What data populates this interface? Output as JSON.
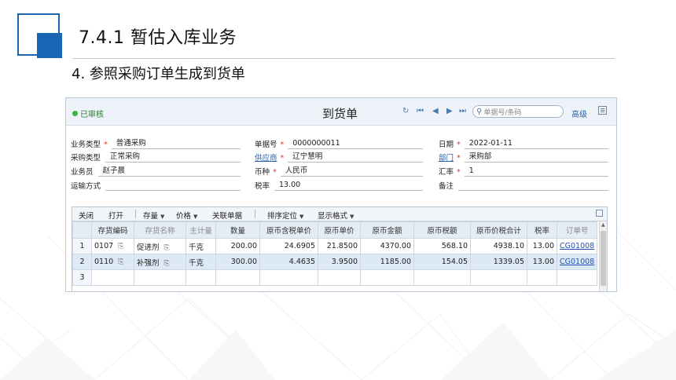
{
  "slide": {
    "title": "7.4.1  暂估入库业务",
    "subtitle": "4. 参照采购订单生成到货单"
  },
  "window": {
    "status": "已审核",
    "form_title": "到货单",
    "search_placeholder": "单据号/条码",
    "advanced_label": "高级",
    "nav": {
      "refresh": "↻",
      "first": "⏮",
      "prev": "◀",
      "next": "▶",
      "last": "⏭"
    }
  },
  "header_fields": {
    "biz_type": {
      "label": "业务类型",
      "value": "普通采购"
    },
    "purchase_type": {
      "label": "采购类型",
      "value": "正常采购"
    },
    "salesman": {
      "label": "业务员",
      "value": "赵子晨"
    },
    "transport": {
      "label": "运输方式",
      "value": ""
    },
    "doc_no": {
      "label": "单据号",
      "value": "0000000011"
    },
    "supplier": {
      "label": "供应商",
      "value": "辽宁慧明"
    },
    "currency": {
      "label": "币种",
      "value": "人民币"
    },
    "tax_rate": {
      "label": "税率",
      "value": "13.00"
    },
    "date": {
      "label": "日期",
      "value": "2022-01-11"
    },
    "dept": {
      "label": "部门",
      "value": "采购部"
    },
    "exrate": {
      "label": "汇率",
      "value": "1"
    },
    "remark": {
      "label": "备注",
      "value": ""
    }
  },
  "toolbar": {
    "close": "关闭",
    "open": "打开",
    "stock": "存量",
    "price": "价格",
    "linked": "关联单据",
    "sort": "排序定位",
    "display": "显示格式"
  },
  "table": {
    "columns": [
      "存货编码",
      "存货名称",
      "主计量",
      "数量",
      "原币含税单价",
      "原币单价",
      "原币金额",
      "原币税额",
      "原币价税合计",
      "税率",
      "订单号"
    ],
    "rows": [
      {
        "idx": "1",
        "code": "0107",
        "name": "促进剂",
        "unit": "千克",
        "qty": "200.00",
        "tax_price": "24.6905",
        "price": "21.8500",
        "amount": "4370.00",
        "tax": "568.10",
        "total": "4938.10",
        "rate": "13.00",
        "order": "CG01008"
      },
      {
        "idx": "2",
        "code": "0110",
        "name": "补强剂",
        "unit": "千克",
        "qty": "300.00",
        "tax_price": "4.4635",
        "price": "3.9500",
        "amount": "1185.00",
        "tax": "154.05",
        "total": "1339.05",
        "rate": "13.00",
        "order": "CG01008"
      },
      {
        "idx": "3",
        "code": "",
        "name": "",
        "unit": "",
        "qty": "",
        "tax_price": "",
        "price": "",
        "amount": "",
        "tax": "",
        "total": "",
        "rate": "",
        "order": ""
      }
    ]
  },
  "colors": {
    "accent": "#1a64b4",
    "status_green": "#3cb043",
    "link": "#1f4fb0",
    "required": "#dd3333"
  }
}
